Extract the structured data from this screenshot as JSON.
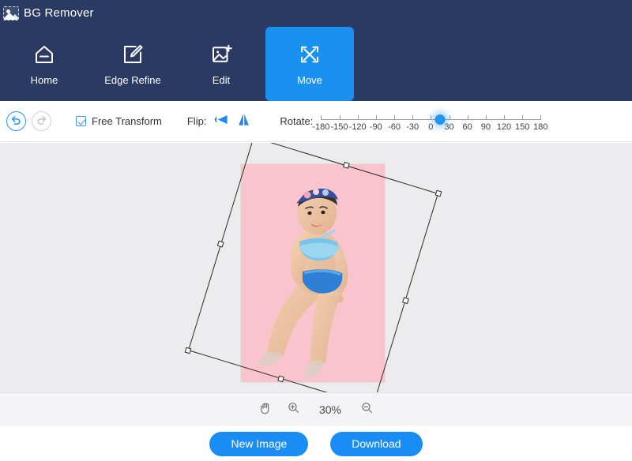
{
  "app": {
    "logo_icon": "image-placeholder-icon",
    "title": "BG Remover",
    "accent_color": "#1a8cf5",
    "header_bg": "#2b3a63",
    "canvas_bg": "#ececee"
  },
  "nav": {
    "items": [
      {
        "label": "Home",
        "icon": "home-icon",
        "active": false
      },
      {
        "label": "Edge Refine",
        "icon": "edge-refine-icon",
        "active": false
      },
      {
        "label": "Edit",
        "icon": "edit-image-icon",
        "active": false
      },
      {
        "label": "Move",
        "icon": "move-arrows-icon",
        "active": true
      }
    ]
  },
  "toolbar": {
    "undo_icon": "undo-arrow-icon",
    "redo_icon": "redo-arrow-icon",
    "undo_enabled": "true",
    "redo_enabled": "false",
    "free_transform_label": "Free Transform",
    "free_transform_checked": "true",
    "flip_label": "Flip:",
    "flip_horizontal_icon": "flip-horizontal-icon",
    "flip_vertical_icon": "flip-vertical-icon",
    "rotate_label": "Rotate:",
    "rotate_value": 15,
    "rotate_min": -180,
    "rotate_max": 180,
    "rotate_ticks": [
      -180,
      -150,
      -120,
      -90,
      -60,
      -30,
      0,
      30,
      60,
      90,
      120,
      150,
      180
    ]
  },
  "canvas": {
    "image_background_color": "#fac4ce",
    "selection_rotation_deg": 17,
    "handles": [
      "top-left-handle",
      "top-center-handle",
      "top-right-handle",
      "middle-left-handle",
      "middle-right-handle",
      "bottom-left-handle",
      "bottom-center-handle",
      "bottom-right-handle"
    ]
  },
  "zoombar": {
    "hand_icon": "hand-tool-icon",
    "zoom_in_icon": "zoom-in-icon",
    "zoom_out_icon": "zoom-out-icon",
    "zoom_level": "30%"
  },
  "footer": {
    "new_image_label": "New Image",
    "download_label": "Download",
    "prev_icon": "chevron-left-icon",
    "next_icon": "chevron-right-icon"
  }
}
